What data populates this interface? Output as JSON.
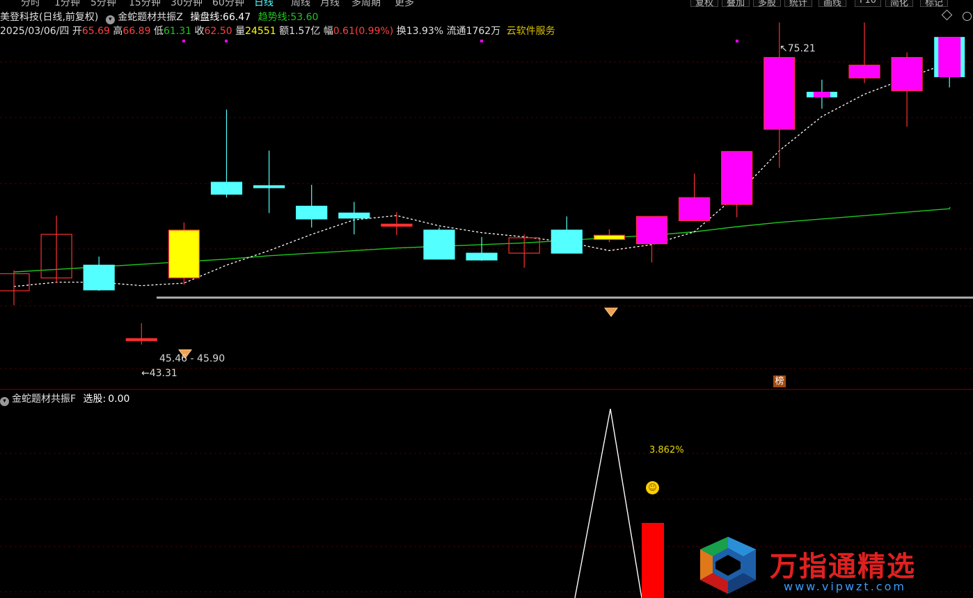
{
  "toolbar": {
    "tabs": [
      "分时",
      "1分钟",
      "5分钟",
      "15分钟",
      "30分钟",
      "60分钟",
      "日线",
      "周线",
      "月线",
      "多周期",
      "更多"
    ],
    "active_tab": "日线",
    "buttons": [
      "复权",
      "叠加",
      "多股",
      "统计",
      "画线",
      "F10",
      "简化",
      "标记"
    ]
  },
  "header": {
    "stock_name": "美登科技",
    "period": "(日线,前复权)",
    "indicator_name": "金蛇题材共振Z",
    "caopan_label": "操盘线:",
    "caopan_value": "66.47",
    "trend_label": "趋势线:",
    "trend_value": "53.60"
  },
  "quote": {
    "date": "2025/03/06/四",
    "open_label": "开",
    "open": "65.69",
    "high_label": "高",
    "high": "66.89",
    "low_label": "低",
    "low": "61.31",
    "close_label": "收",
    "close": "62.50",
    "vol_label": "量",
    "vol": "24551",
    "amount_label": "额",
    "amount": "1.57亿",
    "change_label": "幅",
    "change": "0.61(0.99%)",
    "turnover_label": "换",
    "turnover": "13.93%",
    "float_label": "流通",
    "float": "1762万",
    "service": "云软件服务"
  },
  "sub_panel": {
    "indicator_name": "金蛇题材共振F",
    "select_label": "选股:",
    "select_value": "0.00",
    "percent_label": "3.862%",
    "bang_label": "榜"
  },
  "watermark": {
    "text": "万指通精选",
    "url": "www.vipwzt.com"
  },
  "colors": {
    "up_red": "#ff3030",
    "down_cyan": "#54ffff",
    "magenta": "#ff00ff",
    "yellow": "#ffff00",
    "trend_green": "#1ec81e",
    "caopan_white": "#ffffff",
    "grid_red": "#5a0000"
  },
  "chart_data": {
    "type": "candlestick",
    "price_range": [
      40.5,
      78.5
    ],
    "candles": [
      {
        "o": 49.6,
        "c": 51.6,
        "h": 52.0,
        "l": 47.9,
        "style": "up_hollow"
      },
      {
        "o": 51.1,
        "c": 56.2,
        "h": 58.4,
        "l": 50.5,
        "style": "up_hollow"
      },
      {
        "o": 52.6,
        "c": 49.7,
        "h": 53.6,
        "l": 49.6,
        "style": "down_cyan"
      },
      {
        "o": 44.0,
        "c": 43.9,
        "h": 45.8,
        "l": 43.3,
        "style": "doji_red"
      },
      {
        "o": 51.1,
        "c": 56.7,
        "h": 57.6,
        "l": 50.3,
        "style": "yellow_fill"
      },
      {
        "o": 62.3,
        "c": 60.9,
        "h": 70.8,
        "l": 60.5,
        "style": "down_cyan"
      },
      {
        "o": 61.9,
        "c": 61.7,
        "h": 66.0,
        "l": 58.7,
        "style": "down_cyan"
      },
      {
        "o": 59.5,
        "c": 58.0,
        "h": 62.0,
        "l": 57.0,
        "style": "down_cyan"
      },
      {
        "o": 58.7,
        "c": 58.1,
        "h": 60.0,
        "l": 56.2,
        "style": "down_cyan"
      },
      {
        "o": 57.4,
        "c": 57.2,
        "h": 58.8,
        "l": 56.1,
        "style": "doji_red"
      },
      {
        "o": 56.7,
        "c": 53.3,
        "h": 57.0,
        "l": 53.3,
        "style": "down_cyan"
      },
      {
        "o": 54.0,
        "c": 53.2,
        "h": 55.9,
        "l": 53.1,
        "style": "down_cyan"
      },
      {
        "o": 54.0,
        "c": 55.8,
        "h": 56.2,
        "l": 52.3,
        "style": "up_hollow"
      },
      {
        "o": 56.7,
        "c": 54.0,
        "h": 58.3,
        "l": 54.0,
        "style": "down_cyan"
      },
      {
        "o": 55.6,
        "c": 56.1,
        "h": 56.8,
        "l": 55.3,
        "style": "yellow_bar"
      },
      {
        "o": 55.1,
        "c": 58.3,
        "h": 58.3,
        "l": 52.9,
        "style": "magenta"
      },
      {
        "o": 57.8,
        "c": 60.5,
        "h": 63.3,
        "l": 57.8,
        "style": "magenta"
      },
      {
        "o": 59.7,
        "c": 65.9,
        "h": 65.9,
        "l": 58.2,
        "style": "magenta"
      },
      {
        "o": 68.5,
        "c": 76.9,
        "h": 81.0,
        "l": 64.0,
        "style": "magenta"
      },
      {
        "o": 72.4,
        "c": 72.8,
        "h": 74.3,
        "l": 70.9,
        "style": "cyan_magenta_doji"
      },
      {
        "o": 74.5,
        "c": 76.0,
        "h": 81.0,
        "l": 73.9,
        "style": "magenta"
      },
      {
        "o": 73.0,
        "c": 76.9,
        "h": 77.5,
        "l": 68.8,
        "style": "magenta"
      },
      {
        "o": 79.3,
        "c": 74.6,
        "h": 79.3,
        "l": 73.4,
        "style": "cyan_magenta"
      }
    ],
    "caopan_line": [
      50.1,
      50.6,
      50.6,
      50.2,
      50.5,
      52.6,
      54.3,
      56.2,
      57.9,
      58.4,
      57.2,
      56.4,
      55.9,
      55.3,
      54.3,
      55.0,
      56.5,
      60.8,
      66.0,
      70.0,
      72.6,
      74.5,
      76.3
    ],
    "trend_line": [
      51.8,
      52.1,
      52.4,
      52.7,
      53.0,
      53.3,
      53.7,
      54.0,
      54.3,
      54.6,
      54.8,
      55.0,
      55.2,
      55.5,
      55.8,
      56.1,
      56.5,
      57.1,
      57.6,
      58.0,
      58.4,
      58.8,
      59.2
    ],
    "annotations": {
      "max_label": "75.21",
      "min_label": "43.31",
      "range_label": "45.46 - 45.90",
      "support_price": 48.8
    },
    "sub_line_points": [
      0,
      1,
      0
    ],
    "sub_bar_value": 0.35
  }
}
